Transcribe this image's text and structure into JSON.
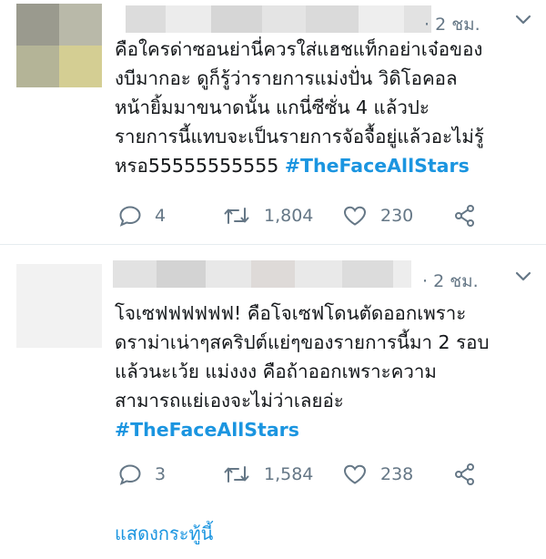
{
  "tweets": [
    {
      "time": "· 2 ชม.",
      "lines": [
        "คือใครด่าซอนย่านี่ควรใส่แฮชแท็กอย่าเจ๋อของ",
        "งบีมากอะ ดูก็รู้ว่ารายการแม่งปั่น วิดิโอคอล",
        "หน้ายิ้มมาขนาดนั้น แกนี่ซีซั่น 4 แล้วปะ",
        "รายการนี้แทบจะเป็นรายการจัอจื้อยู่แล้วอะไม่รู้"
      ],
      "last_line_text": "หรอ55555555555 ",
      "hashtag": "#TheFaceAllStars",
      "replies": "4",
      "retweets": "1,804",
      "likes": "230"
    },
    {
      "time": "· 2 ชม.",
      "lines": [
        "โจเซฟฟฟฟฟฟ! คือโจเซฟโดนตัดออกเพราะ",
        "ดราม่าเน่าๆสคริปต์แย่ๆของรายการนี้มา 2 รอบ",
        "แล้วนะเว้ย แม่งงง คือถ้าออกเพราะความ",
        "สามารถแย่เองจะไม่ว่าเลยอ่ะ"
      ],
      "hashtag": "#TheFaceAllStars",
      "replies": "3",
      "retweets": "1,584",
      "likes": "238"
    }
  ],
  "show_thread": "แสดงกระทู้นี้",
  "icons": {
    "reply": "reply-icon",
    "retweet": "retweet-icon",
    "like": "heart-icon",
    "share": "share-icon",
    "menu": "chevron-down-icon"
  },
  "colors": {
    "hashtag": "#1b95e0",
    "secondary": "#657786",
    "divider": "#e6ecf0"
  }
}
